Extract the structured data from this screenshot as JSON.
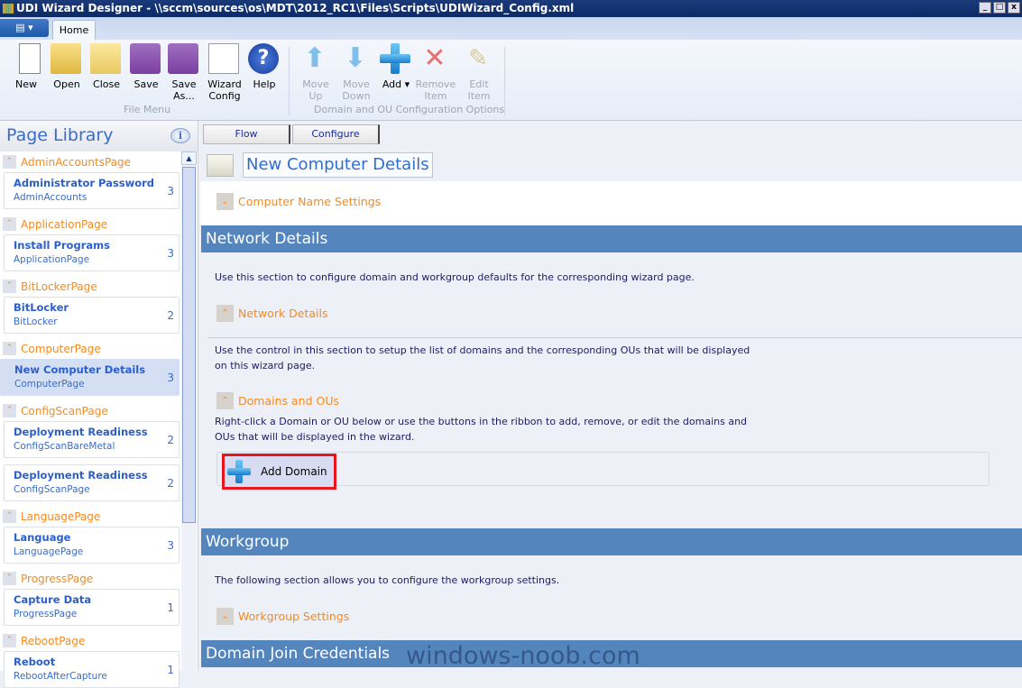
{
  "window": {
    "title": "UDI Wizard Designer - \\\\sccm\\sources\\os\\MDT\\2012_RC1\\Files\\Scripts\\UDIWizard_Config.xml",
    "min": "_",
    "max": "□",
    "close": "x"
  },
  "ribbon": {
    "app_menu": "▤ ▾",
    "tab": "Home",
    "file_group": "File Menu",
    "domain_group": "Domain and OU Configuration Options",
    "buttons": [
      {
        "label": "New",
        "icon": "new-file-icon"
      },
      {
        "label": "Open",
        "icon": "open-folder-icon"
      },
      {
        "label": "Close",
        "icon": "close-folder-icon"
      },
      {
        "label": "Save",
        "icon": "floppy-icon"
      },
      {
        "label": "Save As...",
        "icon": "save-as-icon"
      },
      {
        "label": "Wizard Config",
        "icon": "checklist-icon"
      },
      {
        "label": "Help",
        "icon": "help-icon"
      },
      {
        "label": "Move Up",
        "icon": "arrow-up-icon",
        "disabled": true
      },
      {
        "label": "Move Down",
        "icon": "arrow-down-icon",
        "disabled": true
      },
      {
        "label": "Add ▾",
        "icon": "plus-icon"
      },
      {
        "label": "Remove Item",
        "icon": "x-icon",
        "disabled": true
      },
      {
        "label": "Edit Item",
        "icon": "pencil-icon",
        "disabled": true
      }
    ]
  },
  "library": {
    "title": "Page Library",
    "info": "i",
    "groups": [
      {
        "name": "AdminAccountsPage",
        "items": [
          {
            "title": "Administrator Password",
            "sub": "AdminAccounts",
            "count": "3"
          }
        ]
      },
      {
        "name": "ApplicationPage",
        "items": [
          {
            "title": "Install Programs",
            "sub": "ApplicationPage",
            "count": "3"
          }
        ]
      },
      {
        "name": "BitLockerPage",
        "items": [
          {
            "title": "BitLocker",
            "sub": "BitLocker",
            "count": "2"
          }
        ]
      },
      {
        "name": "ComputerPage",
        "items": [
          {
            "title": "New Computer Details",
            "sub": "ComputerPage",
            "count": "3",
            "selected": true
          }
        ]
      },
      {
        "name": "ConfigScanPage",
        "items": [
          {
            "title": "Deployment Readiness",
            "sub": "ConfigScanBareMetal",
            "count": "2"
          },
          {
            "title": "Deployment Readiness",
            "sub": "ConfigScanPage",
            "count": "2"
          }
        ]
      },
      {
        "name": "LanguagePage",
        "items": [
          {
            "title": "Language",
            "sub": "LanguagePage",
            "count": "3"
          }
        ]
      },
      {
        "name": "ProgressPage",
        "items": [
          {
            "title": "Capture Data",
            "sub": "ProgressPage",
            "count": "1"
          }
        ]
      },
      {
        "name": "RebootPage",
        "items": [
          {
            "title": "Reboot",
            "sub": "RebootAfterCapture",
            "count": "1"
          }
        ]
      }
    ]
  },
  "main": {
    "tabs": [
      "Flow",
      "Configure"
    ],
    "page_title": "New Computer Details",
    "computer_name": "Computer Name Settings",
    "network_band": "Network Details",
    "network_desc": "Use this section to configure domain and workgroup defaults for the corresponding wizard page.",
    "network_exp": "Network Details",
    "domains_desc": "Use the control in this section to setup the list of domains and the corresponding OUs that will be displayed on this wizard page.",
    "domains_exp": "Domains and OUs",
    "domains_help": "Right-click a Domain or OU below or use the buttons in the ribbon to add, remove, or edit the domains and OUs that will be displayed in the wizard.",
    "add_domain": "Add Domain",
    "workgroup_band": "Workgroup",
    "workgroup_desc": "The following section allows you to configure the workgroup settings.",
    "workgroup_exp": "Workgroup Settings",
    "credentials_band": "Domain Join Credentials"
  },
  "watermark": "windows-noob.com",
  "colors": {
    "band": "#5585bd",
    "accent_orange": "#f58a1f",
    "link_blue": "#2b5fcc",
    "highlight": "#e8141e"
  }
}
